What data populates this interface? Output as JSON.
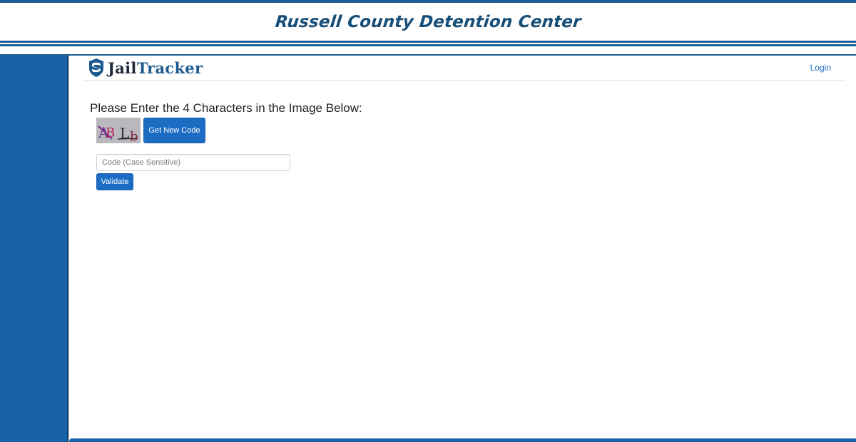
{
  "banner": {
    "title": "Russell County Detention Center"
  },
  "navbar": {
    "brand": {
      "part1": "Jail",
      "part2": "Tracker"
    },
    "login_label": "Login"
  },
  "captcha": {
    "prompt": "Please Enter the 4 Characters in the Image Below:",
    "characters": [
      "A",
      "B",
      "L",
      "b"
    ],
    "new_code_label": "Get New Code",
    "input_placeholder": "Code (Case Sensitive)",
    "input_value": "",
    "validate_label": "Validate"
  },
  "colors": {
    "brand_blue": "#1863a8",
    "button_blue": "#1c6cc4",
    "title_blue": "#174e78",
    "link_blue": "#1a6ec2"
  }
}
